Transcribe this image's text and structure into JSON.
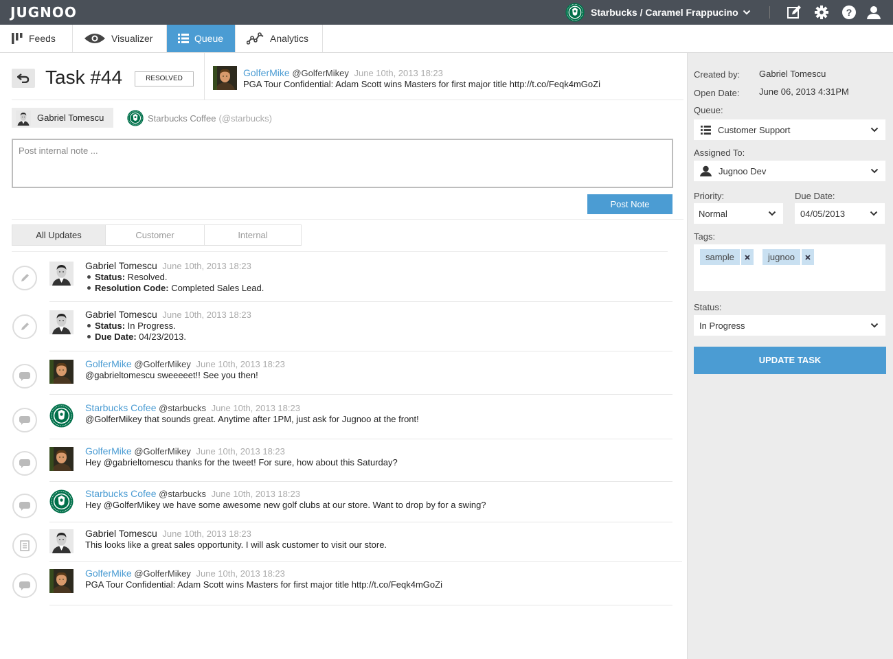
{
  "app": {
    "logo": "JUGNOO",
    "brand_selector": "Starbucks / Caramel Frappucino"
  },
  "nav": {
    "tabs": [
      {
        "label": "Feeds"
      },
      {
        "label": "Visualizer"
      },
      {
        "label": "Queue"
      },
      {
        "label": "Analytics"
      }
    ],
    "active": "Queue"
  },
  "task": {
    "title": "Task #44",
    "badge": "RESOLVED",
    "source_tweet": {
      "user": "GolferMike",
      "handle": "@GolferMikey",
      "time": "June 10th, 2013 18:23",
      "text": "PGA Tour Confidential: Adam Scott wins Masters for first major title http://t.co/Feqk4mGoZi"
    },
    "agent": "Gabriel Tomescu",
    "customer": {
      "name": "Starbucks Coffee",
      "handle": "(@starbucks)"
    }
  },
  "note": {
    "placeholder": "Post internal note ...",
    "button": "Post Note"
  },
  "filters": {
    "tabs": [
      "All Updates",
      "Customer",
      "Internal"
    ],
    "active": "All Updates"
  },
  "feed": [
    {
      "kind": "edit",
      "avatar": "gabriel",
      "name": "Gabriel Tomescu",
      "handle": "",
      "time": "June 10th, 2013 18:23",
      "lines": [
        {
          "key": "Status:",
          "val": " Resolved."
        },
        {
          "key": "Resolution Code:",
          "val": " Completed Sales Lead."
        }
      ]
    },
    {
      "kind": "edit",
      "avatar": "gabriel",
      "name": "Gabriel Tomescu",
      "handle": "",
      "time": "June 10th, 2013 18:23",
      "lines": [
        {
          "key": "Status:",
          "val": " In Progress."
        },
        {
          "key": "Due Date:",
          "val": " 04/23/2013."
        }
      ]
    },
    {
      "kind": "chat",
      "avatar": "mike",
      "name": "GolferMike",
      "handle": "@GolferMikey",
      "time": "June 10th, 2013 18:23",
      "text": "@gabrieltomescu sweeeeet!! See you then!"
    },
    {
      "kind": "chat",
      "avatar": "starbucks",
      "name": "Starbucks Cofee",
      "handle": "@starbucks",
      "time": "June 10th, 2013 18:23",
      "text": "@GolferMikey that sounds great. Anytime after 1PM, just ask for Jugnoo at the front!"
    },
    {
      "kind": "chat",
      "avatar": "mike",
      "name": "GolferMike",
      "handle": "@GolferMikey",
      "time": "June 10th, 2013 18:23",
      "text": "Hey @gabrieltomescu thanks for the tweet! For sure, how about this Saturday?"
    },
    {
      "kind": "chat",
      "avatar": "starbucks",
      "name": "Starbucks Cofee",
      "handle": "@starbucks",
      "time": "June 10th, 2013 18:23",
      "text": "Hey @GolferMikey we have some awesome new golf clubs at our store. Want to drop by for a swing?"
    },
    {
      "kind": "note",
      "avatar": "gabriel",
      "name": "Gabriel Tomescu",
      "handle": "",
      "time": "June 10th, 2013 18:23",
      "text": "This looks like a great sales opportunity. I will ask customer to visit our store."
    },
    {
      "kind": "chat",
      "avatar": "mike",
      "name": "GolferMike",
      "handle": "@GolferMikey",
      "time": "June 10th, 2013 18:23",
      "text": "PGA Tour Confidential: Adam Scott wins Masters for first major title http://t.co/Feqk4mGoZi"
    }
  ],
  "sidebar": {
    "created_by_label": "Created by:",
    "created_by": "Gabriel Tomescu",
    "open_date_label": "Open Date:",
    "open_date": "June 06, 2013 4:31PM",
    "queue_label": "Queue:",
    "queue": "Customer Support",
    "assigned_label": "Assigned To:",
    "assigned": "Jugnoo Dev",
    "priority_label": "Priority:",
    "priority": "Normal",
    "due_label": "Due Date:",
    "due": "04/05/2013",
    "tags_label": "Tags:",
    "tags": [
      "sample",
      "jugnoo"
    ],
    "status_label": "Status:",
    "status": "In Progress",
    "update_button": "UPDATE TASK"
  },
  "colors": {
    "accent": "#4b9cd3",
    "topbar": "#4a5058",
    "sidebar": "#ececec"
  }
}
